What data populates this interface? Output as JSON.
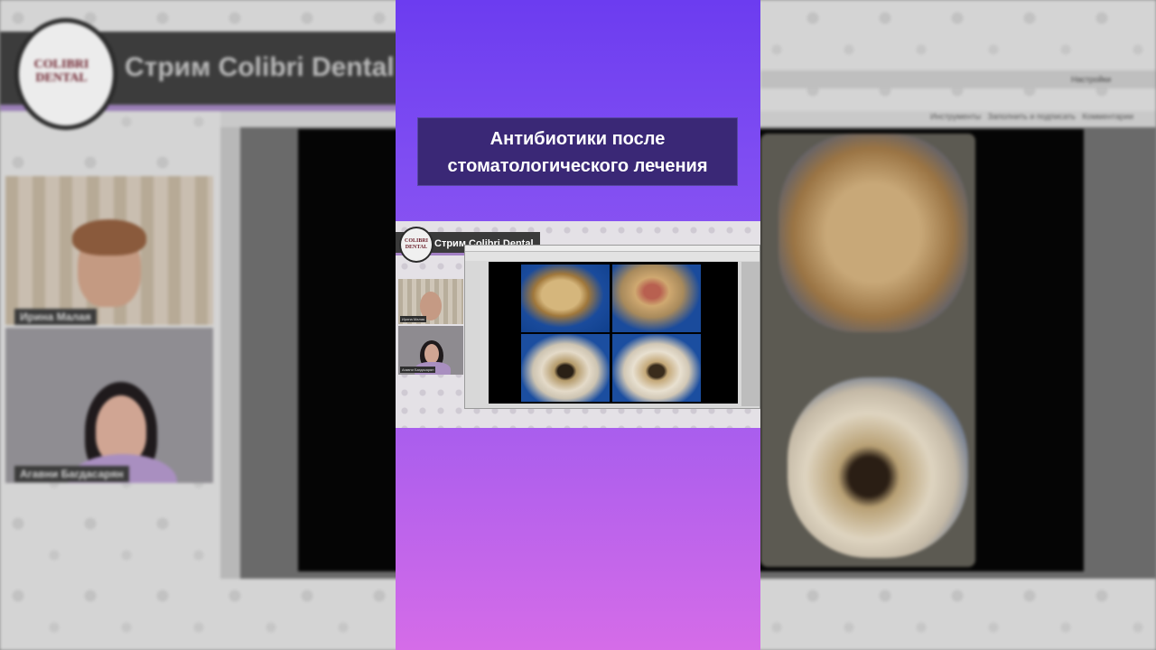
{
  "background": {
    "stream_title": "Стрим Colibri Dental",
    "logo_text_line1": "COLIBRI",
    "logo_text_line2": "DENTAL",
    "participants": [
      {
        "name": "Ирина Малая"
      },
      {
        "name": "Агавни Багдасарян"
      }
    ],
    "app_menu_right": "Настройки",
    "app_tools": [
      "Инструменты",
      "Заполнить и подписать",
      "Комментарии"
    ]
  },
  "panel": {
    "title_line1": "Антибиотики после",
    "title_line2": "стоматологического лечения",
    "inner_stream_title": "Стрим Colibri Dental",
    "inner_logo_line1": "COLIBRI",
    "inner_logo_line2": "DENTAL",
    "inner_participants": [
      {
        "name": "Ирина Малая"
      },
      {
        "name": "Агавни Багдасарян"
      }
    ]
  },
  "colors": {
    "panel_gradient_top": "#6c3cf0",
    "panel_gradient_bottom": "#d56ce8",
    "title_box": "#3a2876",
    "banner": "#3c3c3c",
    "brand_burgundy": "#6a1e2a"
  }
}
